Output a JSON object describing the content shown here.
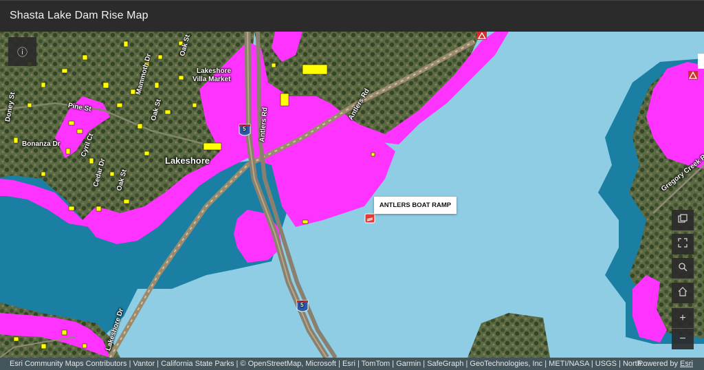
{
  "app": {
    "title": "Shasta Lake Dam Rise Map"
  },
  "map": {
    "colors": {
      "water": "#8ecde3",
      "deep_water": "#1a7fa3",
      "dam_rise_area": "#ff33ff",
      "buildings": "#ffff00",
      "land": "#5b6b44"
    },
    "place_labels": {
      "lakeshore": "Lakeshore",
      "lakeshore_villa_market_1": "Lakeshore",
      "lakeshore_villa_market_2": "Villa Market",
      "bonanza_dr": "Bonanza Dr",
      "pine_st": "Pine St",
      "doney_st": "Doney St",
      "mammoth_dr": "Mammoth Dr",
      "oak_st": "Oak St",
      "cyril_ct": "Cyril Ct",
      "cedar_dr": "Cedar Dr",
      "antlers_rd": "Antlers Rd",
      "antlers_rd_2": "Antlers Rd",
      "lakeshore_dr": "Lakeshore Dr",
      "gregory_creek_rd": "Gregory Creek Rd",
      "interstate_shield_top": "5",
      "interstate_shield_bottom": "5"
    },
    "popup": {
      "label": "ANTLERS BOAT RAMP"
    },
    "markers": {
      "boat_ramp_icon": "boat-ramp-icon",
      "warning_icon": "warning-triangle-icon"
    }
  },
  "controls": {
    "info_icon": "ⓘ",
    "zoom_in": "+",
    "zoom_out": "−"
  },
  "attribution": {
    "sources": "Esri Community Maps Contributors | Vantor | California State Parks | © OpenStreetMap, Microsoft | Esri | TomTom | Garmin | SafeGraph | GeoTechnologies, Inc | METI/NASA | USGS | North...",
    "powered_by": "Powered by",
    "esri": "Esri"
  }
}
